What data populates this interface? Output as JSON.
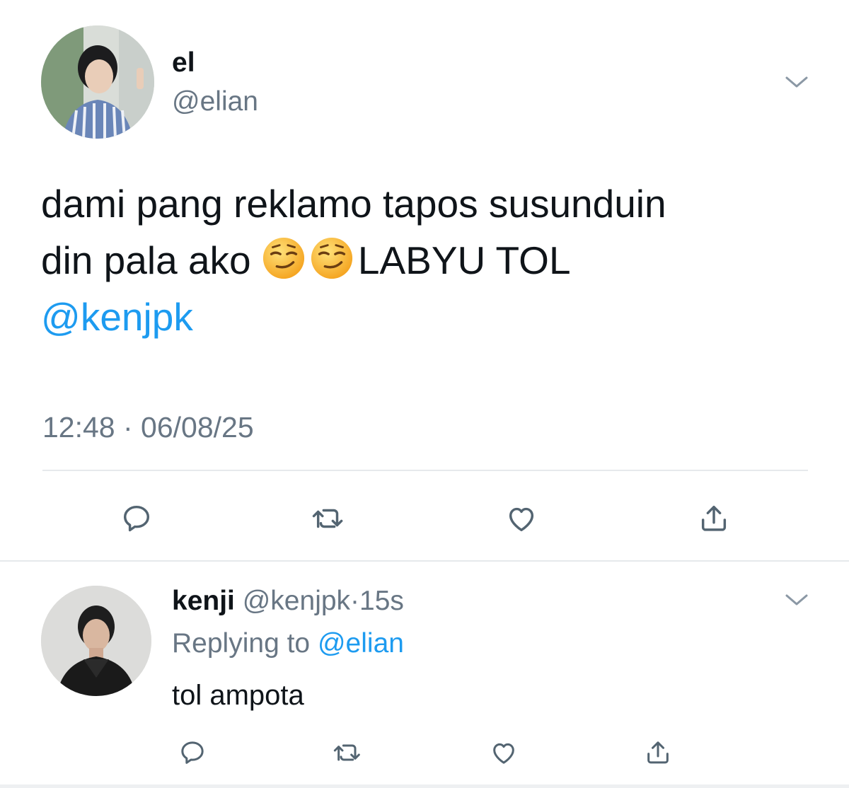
{
  "tweet": {
    "author": {
      "display_name": "el",
      "handle": "@elian"
    },
    "text_line1": "dami pang reklamo tapos susunduin",
    "text_line2_before": "din pala ako",
    "emoji": [
      "smirk-emoji",
      "smirk-emoji"
    ],
    "text_line2_after": "LABYU TOL",
    "mention": "@kenjpk",
    "timestamp": "12:48 · 06/08/25",
    "actions": [
      "reply-icon",
      "retweet-icon",
      "like-icon",
      "share-icon"
    ]
  },
  "reply": {
    "author": {
      "display_name": "kenji",
      "handle": "@kenjpk"
    },
    "separator": "·",
    "time": "15s",
    "replying_label": "Replying to",
    "replying_to": "@elian",
    "text": "tol ampota",
    "actions": [
      "reply-icon",
      "retweet-icon",
      "like-icon",
      "share-icon"
    ]
  },
  "colors": {
    "link": "#1d9bf0",
    "secondary_text": "#687684",
    "icon": "#536471",
    "divider": "#e6e9ec"
  }
}
